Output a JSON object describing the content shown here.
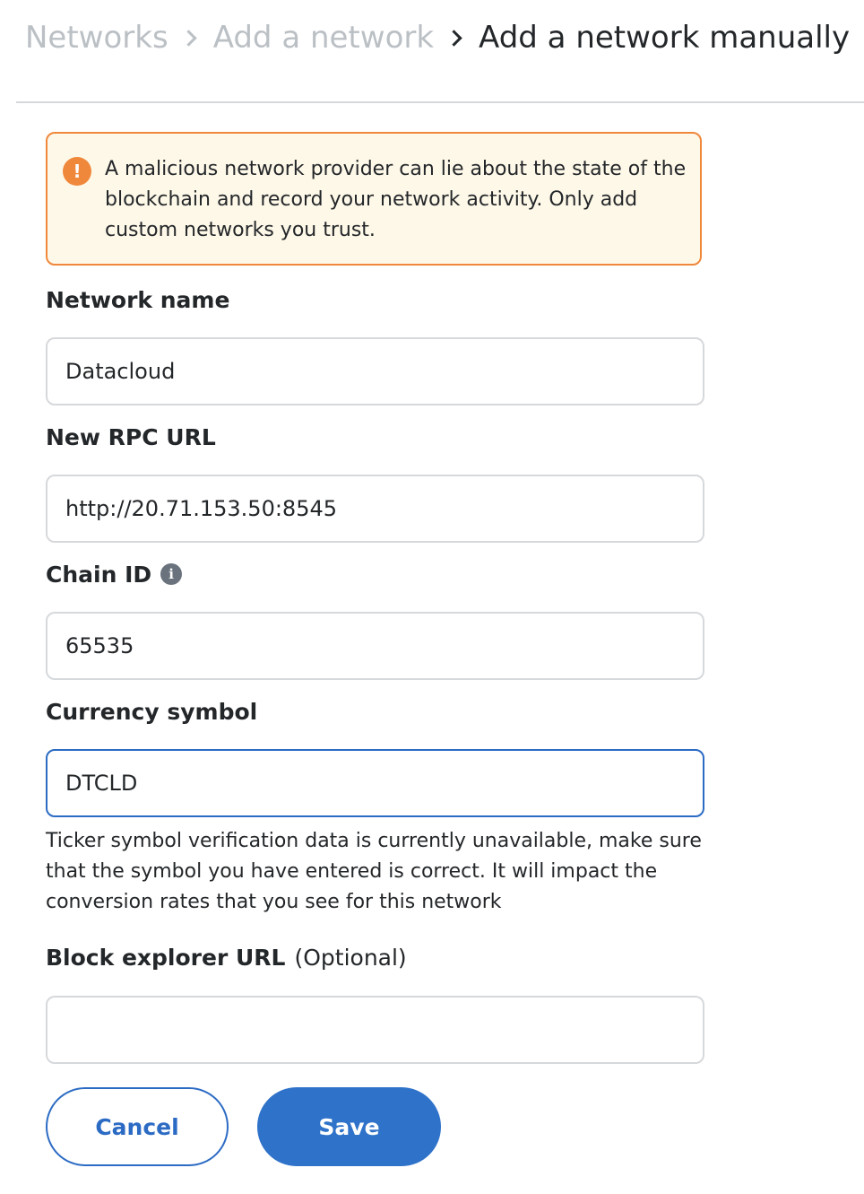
{
  "breadcrumb": {
    "items": [
      "Networks",
      "Add a network",
      "Add a network manually"
    ]
  },
  "warning": {
    "icon": "exclamation-circle-icon",
    "icon_glyph": "!",
    "text": "A malicious network provider can lie about the state of the blockchain and record your network activity. Only add custom networks you trust."
  },
  "form": {
    "network_name": {
      "label": "Network name",
      "value": "Datacloud"
    },
    "rpc_url": {
      "label": "New RPC URL",
      "value": "http://20.71.153.50:8545"
    },
    "chain_id": {
      "label": "Chain ID",
      "info_glyph": "i",
      "value": "65535"
    },
    "currency_symbol": {
      "label": "Currency symbol",
      "value": "DTCLD",
      "helper": "Ticker symbol verification data is currently unavailable, make sure that the symbol you have entered is correct. It will impact the conversion rates that you see for this network"
    },
    "block_explorer": {
      "label": "Block explorer URL",
      "optional": "(Optional)",
      "value": ""
    }
  },
  "buttons": {
    "cancel": "Cancel",
    "save": "Save"
  },
  "colors": {
    "accent": "#2c6bc4",
    "warning_border": "#f0883c",
    "warning_bg": "#fef8e8",
    "muted_text": "#bbc0c5"
  }
}
